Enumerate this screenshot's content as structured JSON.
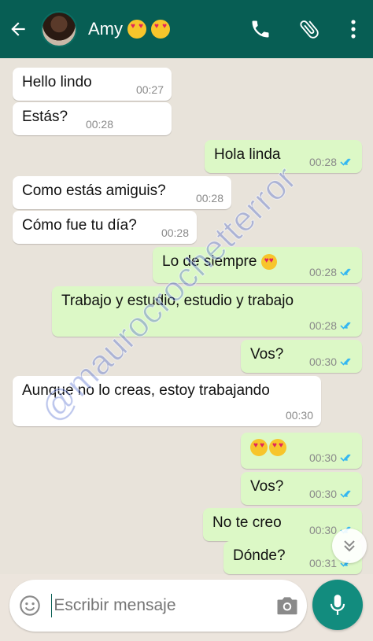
{
  "header": {
    "contact_name": "Amy",
    "status_emojis": [
      "heart-eyes-emoji",
      "heart-eyes-emoji"
    ],
    "icons": [
      "back-arrow-icon",
      "phone-icon",
      "paperclip-icon",
      "more-vert-icon"
    ],
    "colors": {
      "header_bg": "#075e54",
      "incoming_bg": "#ffffff",
      "outgoing_bg": "#dcf8c6",
      "read_tick": "#34b7f1"
    }
  },
  "messages": [
    {
      "direction": "in",
      "text": "Hello lindo",
      "time": "00:27"
    },
    {
      "direction": "in",
      "text": "Estás?",
      "time": "00:28"
    },
    {
      "direction": "out",
      "text": "Hola linda",
      "time": "00:28",
      "status": "read"
    },
    {
      "direction": "in",
      "text": "Como estás amiguis?",
      "time": "00:28"
    },
    {
      "direction": "in",
      "text": "Cómo fue tu día?",
      "time": "00:28"
    },
    {
      "direction": "out",
      "text": "Lo de siempre",
      "emoji": "sweat-smile-emoji",
      "time": "00:28",
      "status": "read"
    },
    {
      "direction": "out",
      "text": "Trabajo y estudio, estudio y trabajo",
      "time": "00:28",
      "status": "read"
    },
    {
      "direction": "out",
      "text": "Vos?",
      "time": "00:30",
      "status": "read"
    },
    {
      "direction": "in",
      "text": "Aunque no lo creas, estoy trabajando",
      "time": "00:30"
    },
    {
      "direction": "out",
      "text": "",
      "emoji": "flushed-emoji x2",
      "time": "00:30",
      "status": "read"
    },
    {
      "direction": "out",
      "text": "Vos?",
      "time": "00:30",
      "status": "read"
    },
    {
      "direction": "out",
      "text": "No te creo",
      "time": "00:30",
      "status": "read"
    },
    {
      "direction": "out",
      "text": "Dónde?",
      "time": "00:31",
      "status": "read"
    }
  ],
  "watermark": "@maurocrochetterror",
  "input": {
    "placeholder": "Escribir mensaje",
    "icons": [
      "emoji-icon",
      "camera-icon",
      "mic-icon",
      "scroll-down-icon"
    ]
  }
}
